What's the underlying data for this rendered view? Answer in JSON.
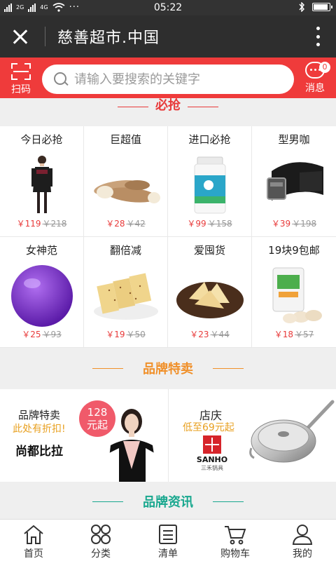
{
  "status_bar": {
    "time": "05:22",
    "network_left": "2G",
    "network_right": "4G",
    "battery_level": 0.95
  },
  "title_bar": {
    "title": "慈善超市.中国"
  },
  "search": {
    "scan_label": "扫码",
    "placeholder": "请输入要搜索的关键字",
    "message_label": "消息",
    "message_badge": "0"
  },
  "sections": {
    "flash": {
      "title": "必抢",
      "color": "#e83a3a"
    },
    "brand_sale": {
      "title": "品牌特卖",
      "color": "#f0902a"
    },
    "brand_news": {
      "title": "品牌资讯",
      "color": "#1aa88f"
    }
  },
  "products": [
    {
      "name": "今日必抢",
      "price": "￥119",
      "old_price": "￥218",
      "icon": "woman-dress-image"
    },
    {
      "name": "巨超值",
      "price": "￥28",
      "old_price": "￥42",
      "icon": "yam-image"
    },
    {
      "name": "进口必抢",
      "price": "￥99",
      "old_price": "￥158",
      "icon": "supplement-bottle-image"
    },
    {
      "name": "型男咖",
      "price": "￥39",
      "old_price": "￥198",
      "icon": "belt-image"
    },
    {
      "name": "女神范",
      "price": "￥25",
      "old_price": "￥93",
      "icon": "yoga-ball-image"
    },
    {
      "name": "翻倍减",
      "price": "￥19",
      "old_price": "￥50",
      "icon": "crackers-image"
    },
    {
      "name": "爱囤货",
      "price": "￥23",
      "old_price": "￥44",
      "icon": "dried-tofu-image"
    },
    {
      "name": "19块9包邮",
      "price": "￥18",
      "old_price": "￥57",
      "icon": "flour-bag-image"
    }
  ],
  "brands": [
    {
      "title": "品牌特卖",
      "subtitle": "此处有折扣!",
      "brand_name": "尚都比拉",
      "tag_line1": "128",
      "tag_line2": "元起"
    },
    {
      "title": "店庆",
      "subtitle": "低至69元起",
      "logo_en": "SANHO",
      "logo_cn": "三禾锅具"
    }
  ],
  "bottom_nav": [
    {
      "label": "首页",
      "icon": "home-icon"
    },
    {
      "label": "分类",
      "icon": "category-icon"
    },
    {
      "label": "清单",
      "icon": "list-icon"
    },
    {
      "label": "购物车",
      "icon": "cart-icon"
    },
    {
      "label": "我的",
      "icon": "profile-icon"
    }
  ]
}
